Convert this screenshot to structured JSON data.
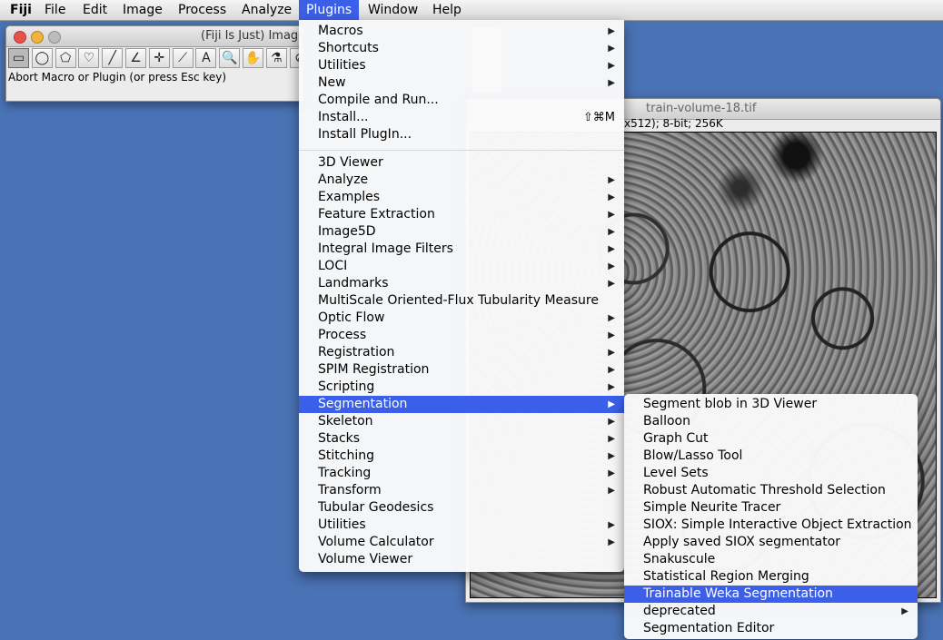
{
  "menubar": {
    "items": [
      "Fiji",
      "File",
      "Edit",
      "Image",
      "Process",
      "Analyze",
      "Plugins",
      "Window",
      "Help"
    ],
    "active": "Plugins"
  },
  "toolbar_window": {
    "title": "(Fiji Is Just) ImageJ",
    "status": "Abort Macro or Plugin (or press Esc key)",
    "tools": [
      "▭",
      "◯",
      "⬠",
      "♡",
      "╱",
      "∠",
      "✛",
      "⟋",
      "A",
      "🔍",
      "✋",
      "⚗",
      "⊘"
    ]
  },
  "image_window": {
    "title": "train-volume-18.tif",
    "info": "x512); 8-bit; 256K"
  },
  "plugins_menu": {
    "group1": [
      {
        "label": "Macros",
        "submenu": true
      },
      {
        "label": "Shortcuts",
        "submenu": true
      },
      {
        "label": "Utilities",
        "submenu": true
      },
      {
        "label": "New",
        "submenu": true
      },
      {
        "label": "Compile and Run...",
        "submenu": false
      },
      {
        "label": "Install...",
        "submenu": false,
        "shortcut": "⇧⌘M"
      },
      {
        "label": "Install PlugIn...",
        "submenu": false
      }
    ],
    "group2": [
      {
        "label": "3D Viewer",
        "submenu": false
      },
      {
        "label": "Analyze",
        "submenu": true
      },
      {
        "label": "Examples",
        "submenu": true
      },
      {
        "label": "Feature Extraction",
        "submenu": true
      },
      {
        "label": "Image5D",
        "submenu": true
      },
      {
        "label": "Integral Image Filters",
        "submenu": true
      },
      {
        "label": "LOCI",
        "submenu": true
      },
      {
        "label": "Landmarks",
        "submenu": true
      },
      {
        "label": "MultiScale Oriented-Flux Tubularity Measure",
        "submenu": false
      },
      {
        "label": "Optic Flow",
        "submenu": true
      },
      {
        "label": "Process",
        "submenu": true
      },
      {
        "label": "Registration",
        "submenu": true
      },
      {
        "label": "SPIM Registration",
        "submenu": true
      },
      {
        "label": "Scripting",
        "submenu": true
      },
      {
        "label": "Segmentation",
        "submenu": true,
        "highlighted": true
      },
      {
        "label": "Skeleton",
        "submenu": true
      },
      {
        "label": "Stacks",
        "submenu": true
      },
      {
        "label": "Stitching",
        "submenu": true
      },
      {
        "label": "Tracking",
        "submenu": true
      },
      {
        "label": "Transform",
        "submenu": true
      },
      {
        "label": "Tubular Geodesics",
        "submenu": false
      },
      {
        "label": "Utilities",
        "submenu": true
      },
      {
        "label": "Volume Calculator",
        "submenu": true
      },
      {
        "label": "Volume Viewer",
        "submenu": false
      }
    ]
  },
  "segmentation_menu": [
    {
      "label": "Segment blob in 3D Viewer",
      "submenu": false
    },
    {
      "label": "Balloon",
      "submenu": false
    },
    {
      "label": "Graph Cut",
      "submenu": false
    },
    {
      "label": "Blow/Lasso Tool",
      "submenu": false
    },
    {
      "label": "Level Sets",
      "submenu": false
    },
    {
      "label": "Robust Automatic Threshold Selection",
      "submenu": false
    },
    {
      "label": "Simple Neurite Tracer",
      "submenu": false
    },
    {
      "label": "SIOX: Simple Interactive Object Extraction",
      "submenu": false
    },
    {
      "label": "Apply saved SIOX segmentator",
      "submenu": false
    },
    {
      "label": "Snakuscule",
      "submenu": false
    },
    {
      "label": "Statistical Region Merging",
      "submenu": false
    },
    {
      "label": "Trainable Weka Segmentation",
      "submenu": false,
      "highlighted": true
    },
    {
      "label": "deprecated",
      "submenu": true
    },
    {
      "label": "Segmentation Editor",
      "submenu": false
    }
  ],
  "icons": {
    "submenu_arrow": "▶"
  }
}
